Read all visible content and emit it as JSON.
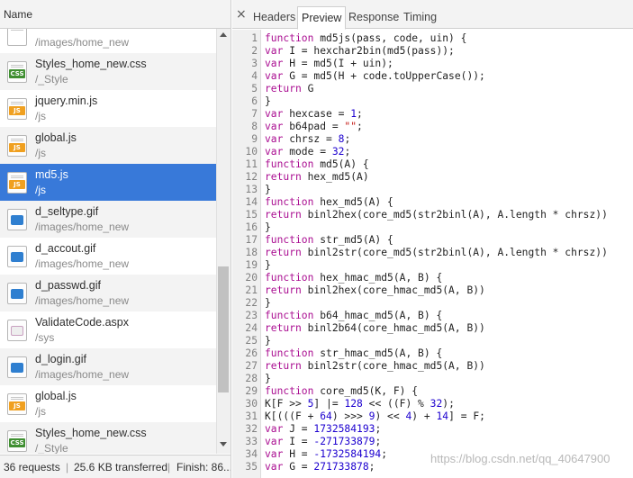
{
  "left_panel": {
    "column_header": "Name",
    "files": [
      {
        "name": "",
        "path": "/images/home_new",
        "icon": "blank-file-icon"
      },
      {
        "name": "Styles_home_new.css",
        "path": "/_Style",
        "icon": "css-file-icon"
      },
      {
        "name": "jquery.min.js",
        "path": "/js",
        "icon": "js-file-icon"
      },
      {
        "name": "global.js",
        "path": "/js",
        "icon": "js-file-icon"
      },
      {
        "name": "md5.js",
        "path": "/js",
        "icon": "js-file-icon",
        "selected": true
      },
      {
        "name": "d_seltype.gif",
        "path": "/images/home_new",
        "icon": "image-file-icon"
      },
      {
        "name": "d_accout.gif",
        "path": "/images/home_new",
        "icon": "user-image-icon"
      },
      {
        "name": "d_passwd.gif",
        "path": "/images/home_new",
        "icon": "lock-image-icon"
      },
      {
        "name": "ValidateCode.aspx",
        "path": "/sys",
        "icon": "captcha-image-icon"
      },
      {
        "name": "d_login.gif",
        "path": "/images/home_new",
        "icon": "image-file-icon"
      },
      {
        "name": "global.js",
        "path": "/js",
        "icon": "js-file-icon"
      },
      {
        "name": "Styles_home_new.css",
        "path": "/_Style",
        "icon": "css-file-icon"
      }
    ],
    "status": {
      "requests": "36 requests",
      "transferred": "25.6 KB transferred",
      "finish": "Finish: 86..."
    }
  },
  "right_panel": {
    "close_glyph": "×",
    "tabs": [
      {
        "label": "Headers"
      },
      {
        "label": "Preview",
        "active": true
      },
      {
        "label": "Response"
      },
      {
        "label": "Timing"
      }
    ],
    "code_lines": [
      "function md5js(pass, code, uin) {",
      "var I = hexchar2bin(md5(pass));",
      "var H = md5(I + uin);",
      "var G = md5(H + code.toUpperCase());",
      "return G",
      "}",
      "var hexcase = 1;",
      "var b64pad = \"\";",
      "var chrsz = 8;",
      "var mode = 32;",
      "function md5(A) {",
      "return hex_md5(A)",
      "}",
      "function hex_md5(A) {",
      "return binl2hex(core_md5(str2binl(A), A.length * chrsz))",
      "}",
      "function str_md5(A) {",
      "return binl2str(core_md5(str2binl(A), A.length * chrsz))",
      "}",
      "function hex_hmac_md5(A, B) {",
      "return binl2hex(core_hmac_md5(A, B))",
      "}",
      "function b64_hmac_md5(A, B) {",
      "return binl2b64(core_hmac_md5(A, B))",
      "}",
      "function str_hmac_md5(A, B) {",
      "return binl2str(core_hmac_md5(A, B))",
      "}",
      "function core_md5(K, F) {",
      "K[F >> 5] |= 128 << ((F) % 32);",
      "K[(((F + 64) >>> 9) << 4) + 14] = F;",
      "var J = 1732584193;",
      "var I = -271733879;",
      "var H = -1732584194;",
      "var G = 271733878;"
    ],
    "watermark": "https://blog.csdn.net/qq_40647900"
  },
  "colors": {
    "selection": "#3879d9",
    "keyword": "#aa0d91",
    "string": "#c41a16",
    "number": "#1c00cf"
  }
}
